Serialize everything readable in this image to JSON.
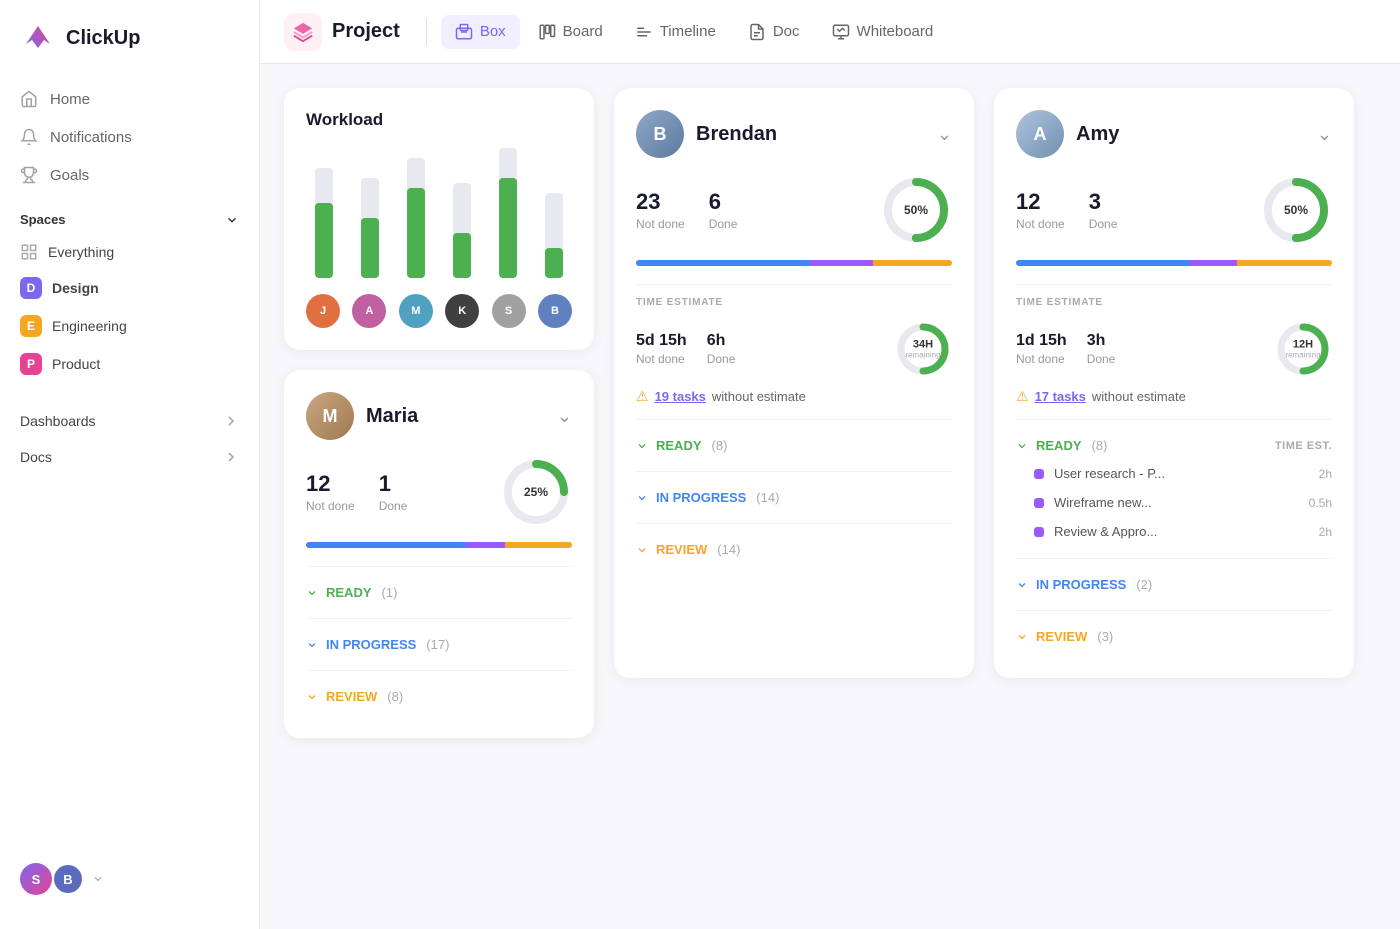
{
  "logo": {
    "text": "ClickUp"
  },
  "sidebar": {
    "nav": [
      {
        "id": "home",
        "label": "Home",
        "icon": "home"
      },
      {
        "id": "notifications",
        "label": "Notifications",
        "icon": "bell"
      },
      {
        "id": "goals",
        "label": "Goals",
        "icon": "trophy"
      }
    ],
    "spaces_label": "Spaces",
    "everything_label": "Everything",
    "spaces": [
      {
        "id": "design",
        "label": "Design",
        "initial": "D",
        "color": "purple",
        "active": true
      },
      {
        "id": "engineering",
        "label": "Engineering",
        "initial": "E",
        "color": "yellow"
      },
      {
        "id": "product",
        "label": "Product",
        "initial": "P",
        "color": "pink"
      }
    ],
    "dashboards_label": "Dashboards",
    "docs_label": "Docs"
  },
  "topnav": {
    "project_label": "Project",
    "tabs": [
      {
        "id": "box",
        "label": "Box",
        "icon": "box"
      },
      {
        "id": "board",
        "label": "Board",
        "icon": "board"
      },
      {
        "id": "timeline",
        "label": "Timeline",
        "icon": "timeline"
      },
      {
        "id": "doc",
        "label": "Doc",
        "icon": "doc"
      },
      {
        "id": "whiteboard",
        "label": "Whiteboard",
        "icon": "whiteboard"
      }
    ]
  },
  "workload": {
    "title": "Workload",
    "bars": [
      {
        "height_bg": 110,
        "height_fill": 75
      },
      {
        "height_bg": 100,
        "height_fill": 60
      },
      {
        "height_bg": 120,
        "height_fill": 90
      },
      {
        "height_bg": 95,
        "height_fill": 45
      },
      {
        "height_bg": 130,
        "height_fill": 100
      },
      {
        "height_bg": 85,
        "height_fill": 30
      }
    ],
    "avatars": [
      "J",
      "A",
      "M",
      "K",
      "S",
      "B"
    ]
  },
  "brendan": {
    "name": "Brendan",
    "not_done_count": "23",
    "not_done_label": "Not done",
    "done_count": "6",
    "done_label": "Done",
    "progress_pct": 50,
    "donut_label": "50%",
    "progress_segments": [
      55,
      20,
      25
    ],
    "time_estimate_label": "TIME ESTIMATE",
    "time_notdone": "5d 15h",
    "time_notdone_label": "Not done",
    "time_done": "6h",
    "time_done_label": "Done",
    "donut2_label": "34H",
    "donut2_sub": "remaining",
    "warning_count": "19 tasks",
    "warning_text": " without estimate",
    "statuses": [
      {
        "type": "ready",
        "label": "READY",
        "count": "(8)"
      },
      {
        "type": "progress",
        "label": "IN PROGRESS",
        "count": "(14)"
      },
      {
        "type": "review",
        "label": "REVIEW",
        "count": "(14)"
      }
    ]
  },
  "amy": {
    "name": "Amy",
    "not_done_count": "12",
    "not_done_label": "Not done",
    "done_count": "3",
    "done_label": "Done",
    "progress_pct": 50,
    "donut_label": "50%",
    "time_estimate_label": "TIME ESTIMATE",
    "time_notdone": "1d 15h",
    "time_notdone_label": "Not done",
    "time_done": "3h",
    "time_done_label": "Done",
    "donut2_label": "12H",
    "donut2_sub": "remaining",
    "warning_count": "17 tasks",
    "warning_text": " without estimate",
    "statuses": [
      {
        "type": "ready",
        "label": "READY",
        "count": "(8)",
        "show_time_est": true
      },
      {
        "type": "progress",
        "label": "IN PROGRESS",
        "count": "(2)"
      },
      {
        "type": "review",
        "label": "REVIEW",
        "count": "(3)"
      }
    ],
    "tasks": [
      {
        "name": "User research - P...",
        "time": "2h"
      },
      {
        "name": "Wireframe new...",
        "time": "0.5h"
      },
      {
        "name": "Review & Appro...",
        "time": "2h"
      }
    ],
    "time_est_col": "TIME EST."
  },
  "maria": {
    "name": "Maria",
    "not_done_count": "12",
    "not_done_label": "Not done",
    "done_count": "1",
    "done_label": "Done",
    "progress_pct": 25,
    "donut_label": "25%",
    "progress_segments": [
      60,
      15,
      25
    ],
    "statuses": [
      {
        "type": "ready",
        "label": "READY",
        "count": "(1)"
      },
      {
        "type": "progress",
        "label": "IN PROGRESS",
        "count": "(17)"
      },
      {
        "type": "review",
        "label": "REVIEW",
        "count": "(8)"
      }
    ]
  }
}
